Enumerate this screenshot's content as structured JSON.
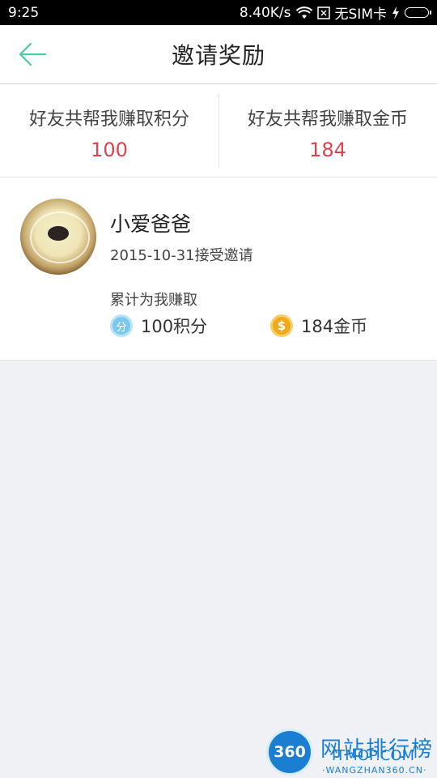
{
  "status_bar": {
    "time": "9:25",
    "network_speed": "8.40K/s",
    "sim": "无SIM卡",
    "icons": [
      "wifi-icon",
      "sim-icon",
      "charging-icon",
      "battery-icon"
    ]
  },
  "header": {
    "title": "邀请奖励",
    "back_icon": "back-arrow-icon",
    "accent_color": "#4cc7a5"
  },
  "stats": {
    "points": {
      "label": "好友共帮我赚取积分",
      "value": "100"
    },
    "coins": {
      "label": "好友共帮我赚取金币",
      "value": "184"
    },
    "value_color": "#d9444f"
  },
  "invitee": {
    "name": "小爱爸爸",
    "date": "2015-10-31接受邀请",
    "earned_label": "累计为我赚取",
    "points_icon_text": "分",
    "points": "100积分",
    "coins_icon_text": "$",
    "coins": "184金币"
  },
  "watermark": {
    "logo": "360",
    "text": "网站排行榜",
    "sub": "ITMOP.COM",
    "sub2": "·WANGZHAN360.CN·"
  }
}
